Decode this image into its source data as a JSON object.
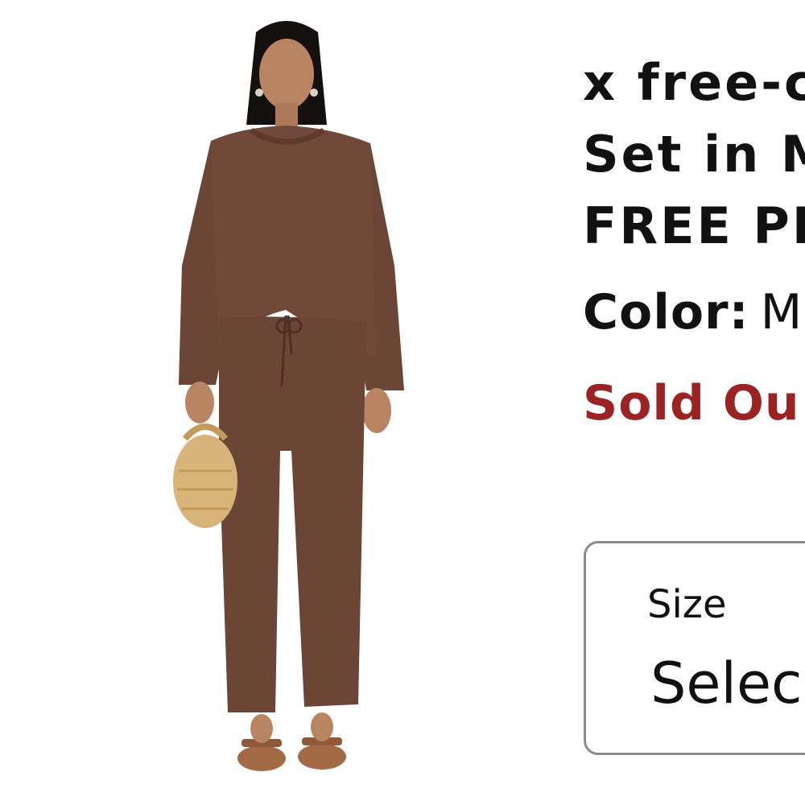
{
  "product": {
    "title_lines": [
      "x free-c",
      "Set in M",
      "FREE PE"
    ],
    "color_label": "Color:",
    "color_value": "M",
    "stock_status": "Sold Ou",
    "size_label": "Size",
    "size_value": "Selec"
  },
  "colors": {
    "garment": "#6b4536",
    "sold_out": "#9b2323",
    "select_border": "#8a8a8a",
    "bag": "#d8b47a"
  },
  "icons": {
    "product_photo": "model-wearing-knit-set-photo"
  }
}
